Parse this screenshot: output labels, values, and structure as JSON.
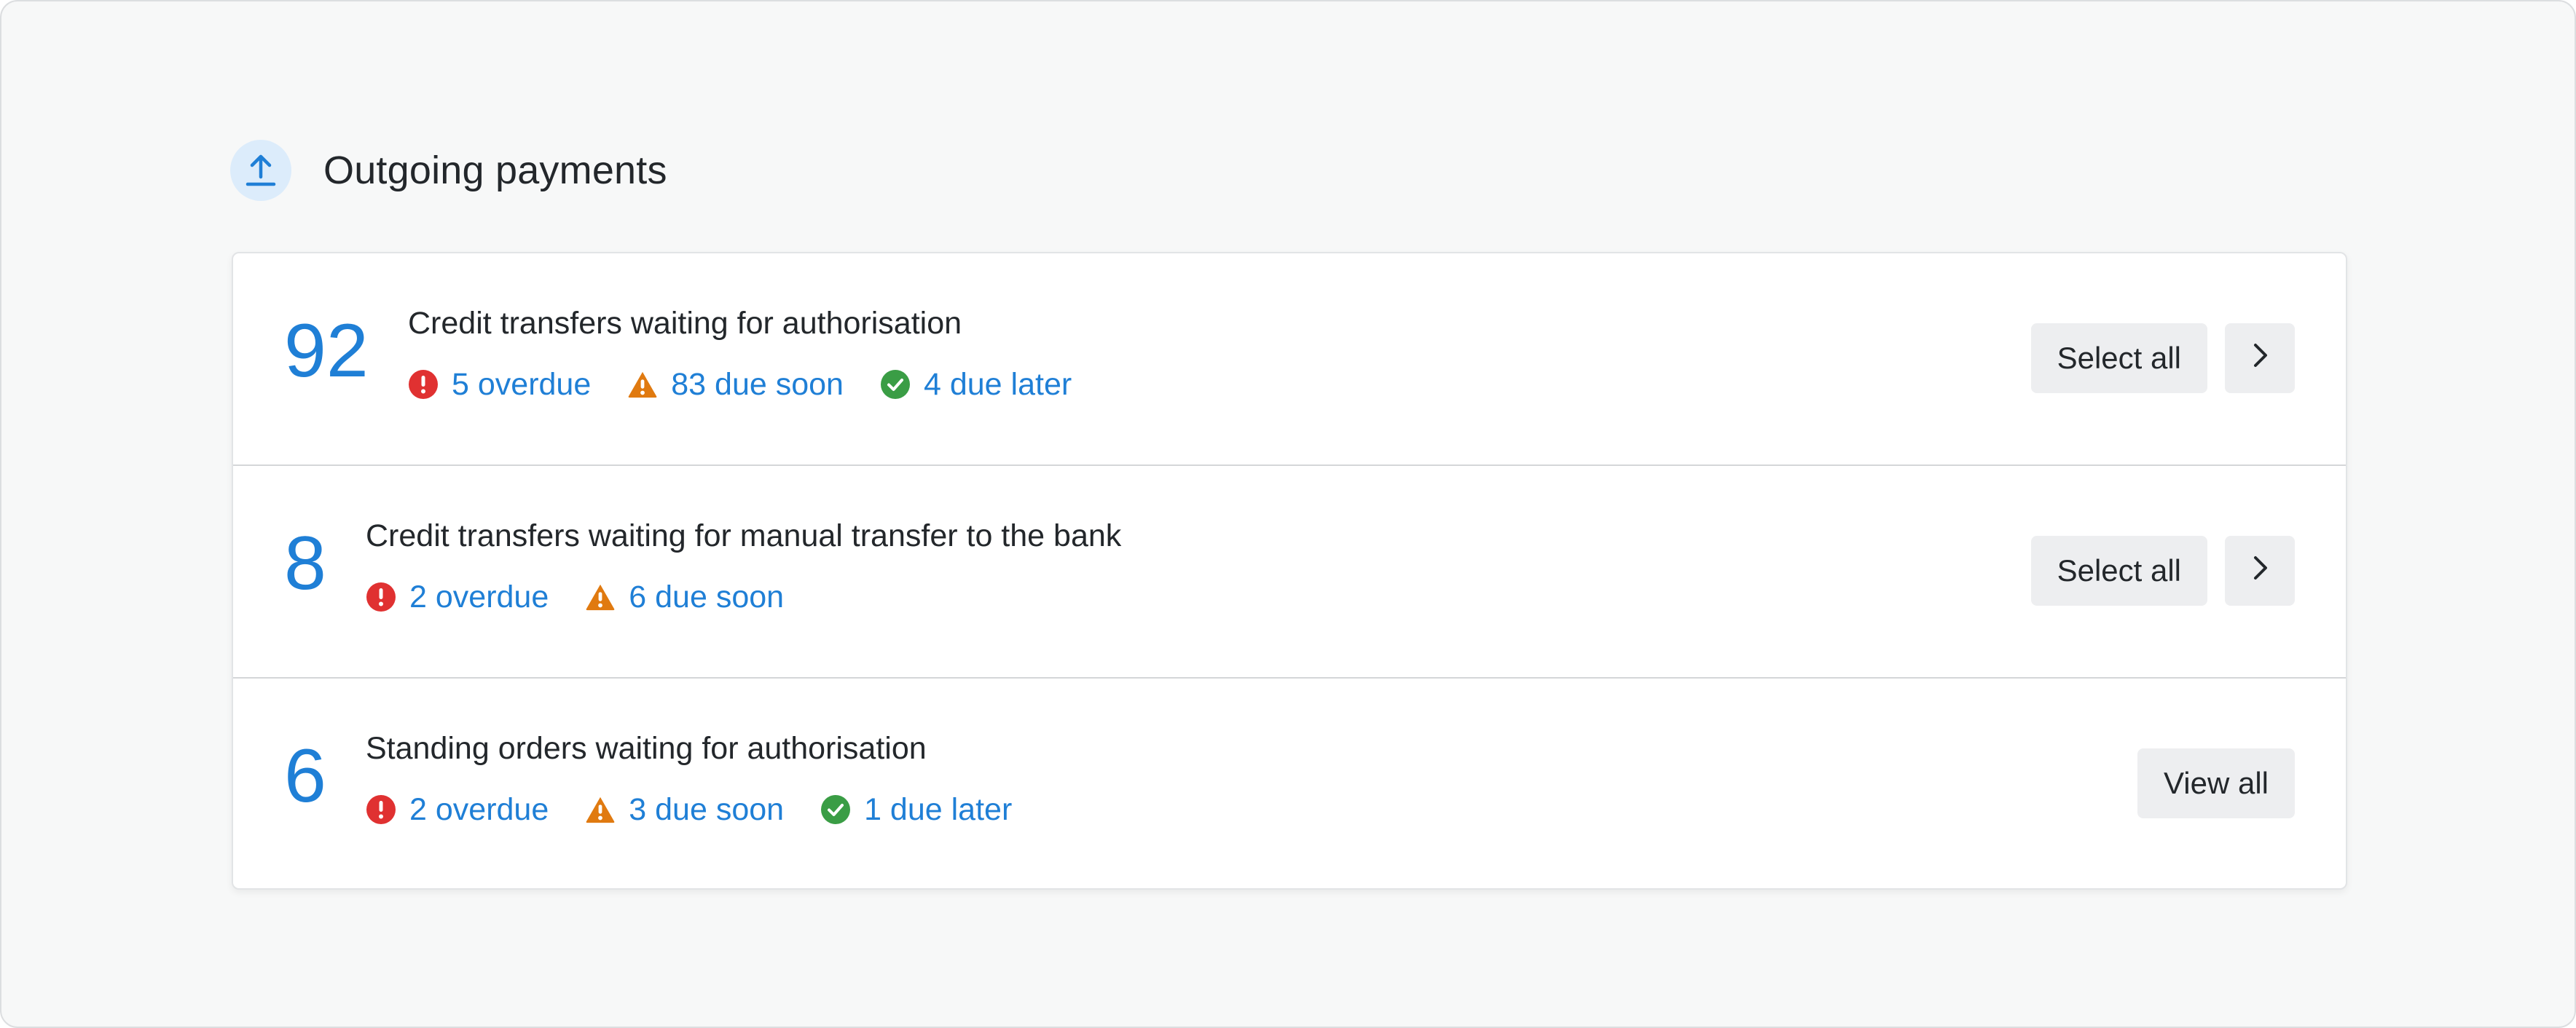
{
  "section": {
    "title": "Outgoing payments",
    "icon": "upload-arrow-icon",
    "accent_color": "#1f7fd6"
  },
  "rows": [
    {
      "count": "92",
      "title": "Credit transfers waiting for authorisation",
      "statuses": [
        {
          "type": "overdue",
          "icon": "error-icon",
          "label": "5 overdue"
        },
        {
          "type": "due-soon",
          "icon": "warning-icon",
          "label": "83 due soon"
        },
        {
          "type": "due-later",
          "icon": "check-icon",
          "label": "4 due later"
        }
      ],
      "primary_action": "Select all",
      "secondary_action_icon": "chevron-right-icon"
    },
    {
      "count": "8",
      "title": "Credit transfers waiting for manual transfer to the bank",
      "statuses": [
        {
          "type": "overdue",
          "icon": "error-icon",
          "label": "2 overdue"
        },
        {
          "type": "due-soon",
          "icon": "warning-icon",
          "label": "6 due soon"
        }
      ],
      "primary_action": "Select all",
      "secondary_action_icon": "chevron-right-icon"
    },
    {
      "count": "6",
      "title": "Standing orders waiting for authorisation",
      "statuses": [
        {
          "type": "overdue",
          "icon": "error-icon",
          "label": "2 overdue"
        },
        {
          "type": "due-soon",
          "icon": "warning-icon",
          "label": "3 due soon"
        },
        {
          "type": "due-later",
          "icon": "check-icon",
          "label": "1 due later"
        }
      ],
      "primary_action": "View all"
    }
  ],
  "colors": {
    "count": "#1f7fd6",
    "link": "#1f7fd6",
    "overdue": "#e03131",
    "due_soon": "#e07a10",
    "due_later": "#3a9d45",
    "button_bg": "#edeef0"
  }
}
